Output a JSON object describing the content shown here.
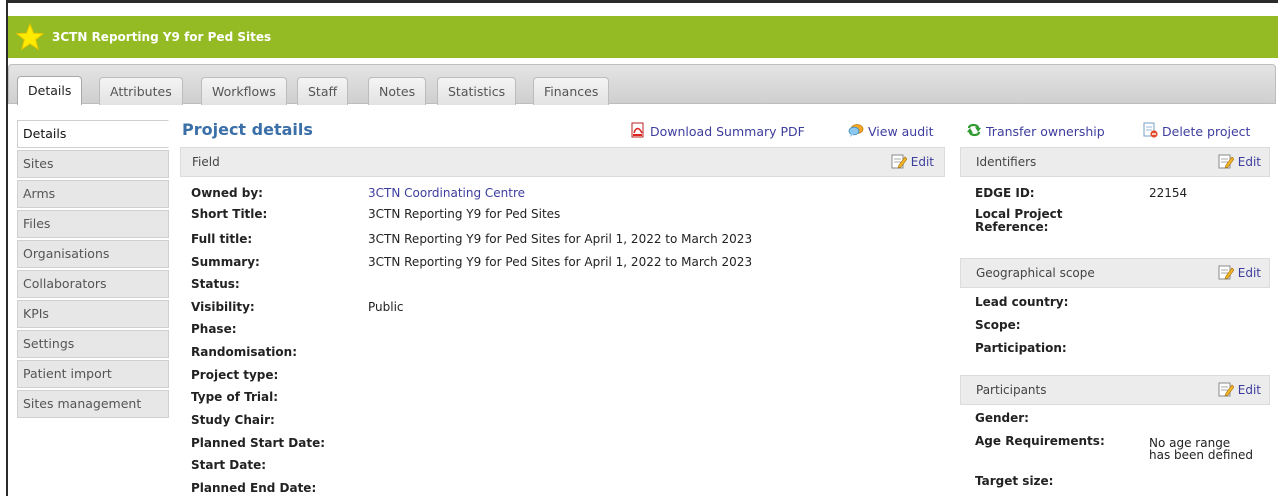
{
  "banner": {
    "title": "3CTN Reporting Y9 for Ped Sites"
  },
  "tabs": [
    {
      "label": "Details"
    },
    {
      "label": "Attributes"
    },
    {
      "label": "Workflows"
    },
    {
      "label": "Staff"
    },
    {
      "label": "Notes"
    },
    {
      "label": "Statistics"
    },
    {
      "label": "Finances"
    }
  ],
  "sidenav": [
    {
      "label": "Details"
    },
    {
      "label": "Sites"
    },
    {
      "label": "Arms"
    },
    {
      "label": "Files"
    },
    {
      "label": "Organisations"
    },
    {
      "label": "Collaborators"
    },
    {
      "label": "KPIs"
    },
    {
      "label": "Settings"
    },
    {
      "label": "Patient import"
    },
    {
      "label": "Sites management"
    }
  ],
  "main": {
    "title": "Project details",
    "download_pdf": "Download Summary PDF",
    "view_audit": "View audit",
    "field_header": "Field",
    "edit": "Edit",
    "fields": [
      {
        "label": "Owned by:",
        "value": "3CTN Coordinating Centre"
      },
      {
        "label": "Short Title:",
        "value": "3CTN Reporting Y9 for Ped Sites"
      },
      {
        "label": "Full title:",
        "value": "3CTN Reporting Y9 for Ped Sites for April 1, 2022 to March 2023"
      },
      {
        "label": "Summary:",
        "value": "3CTN Reporting Y9 for Ped Sites for April 1, 2022 to March 2023"
      },
      {
        "label": "Status:",
        "value": ""
      },
      {
        "label": "Visibility:",
        "value": "Public"
      },
      {
        "label": "Phase:",
        "value": ""
      },
      {
        "label": "Randomisation:",
        "value": ""
      },
      {
        "label": "Project type:",
        "value": ""
      },
      {
        "label": "Type of Trial:",
        "value": ""
      },
      {
        "label": "Study Chair:",
        "value": ""
      },
      {
        "label": "Planned Start Date:",
        "value": ""
      },
      {
        "label": "Start Date:",
        "value": ""
      },
      {
        "label": "Planned End Date:",
        "value": ""
      }
    ]
  },
  "right": {
    "transfer": "Transfer ownership",
    "delete": "Delete project",
    "edit": "Edit",
    "identifiers": {
      "title": "Identifiers",
      "edge_label": "EDGE ID:",
      "edge_value": "22154",
      "local_label_1": "Local Project",
      "local_label_2": "Reference:"
    },
    "geo": {
      "title": "Geographical scope",
      "lead": "Lead country:",
      "scope": "Scope:",
      "participation": "Participation:"
    },
    "participants": {
      "title": "Participants",
      "gender": "Gender:",
      "age_label": "Age Requirements:",
      "age_value_1": "No age range",
      "age_value_2": "has been defined",
      "target": "Target size:"
    }
  },
  "colors": {
    "banner": "#94bb23",
    "link": "#3d3d9e",
    "title": "#3a6fa8"
  }
}
